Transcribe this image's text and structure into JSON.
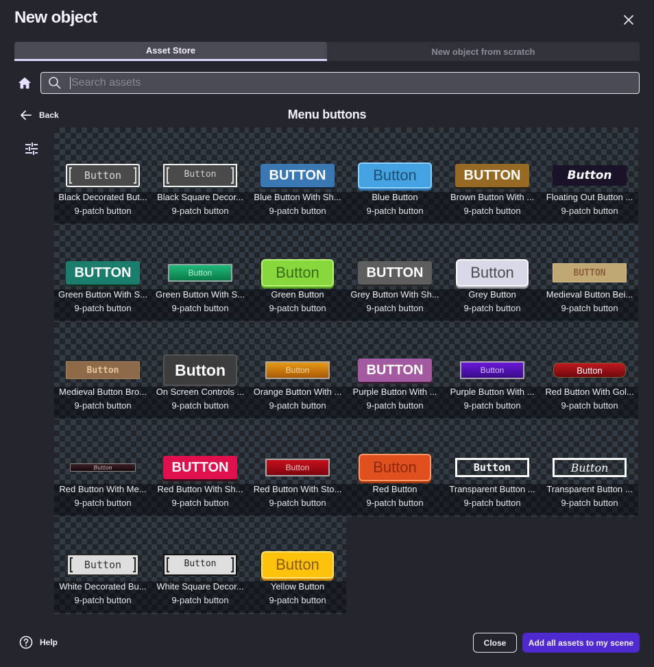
{
  "dialog": {
    "title": "New object",
    "close_icon": "close-icon"
  },
  "tabs": [
    {
      "label": "Asset Store",
      "active": true
    },
    {
      "label": "New object from scratch",
      "active": false
    }
  ],
  "search": {
    "placeholder": "Search assets",
    "value": "",
    "home_icon": "home-icon",
    "search_icon": "search-icon"
  },
  "nav": {
    "back_label": "Back",
    "section_title": "Menu buttons",
    "filter_icon": "tune-filter-icon"
  },
  "assets": [
    {
      "name": "Black Decorated But...",
      "kind": "9-patch button",
      "preview_text": "Button",
      "style": "black-decorated"
    },
    {
      "name": "Black Square Decor...",
      "kind": "9-patch button",
      "preview_text": "Button",
      "style": "black-square"
    },
    {
      "name": "Blue Button With Sh...",
      "kind": "9-patch button",
      "preview_text": "BUTTON",
      "style": "blue-shadow"
    },
    {
      "name": "Blue Button",
      "kind": "9-patch button",
      "preview_text": "Button",
      "style": "blue"
    },
    {
      "name": "Brown Button With ...",
      "kind": "9-patch button",
      "preview_text": "BUTTON",
      "style": "brown-shadow"
    },
    {
      "name": "Floating Out Button ...",
      "kind": "9-patch button",
      "preview_text": "Button",
      "style": "floating-out"
    },
    {
      "name": "Green Button With S...",
      "kind": "9-patch button",
      "preview_text": "BUTTON",
      "style": "green-shadow"
    },
    {
      "name": "Green Button With S...",
      "kind": "9-patch button",
      "preview_text": "Button",
      "style": "green-stone"
    },
    {
      "name": "Green Button",
      "kind": "9-patch button",
      "preview_text": "Button",
      "style": "green"
    },
    {
      "name": "Grey Button With Sh...",
      "kind": "9-patch button",
      "preview_text": "BUTTON",
      "style": "grey-shadow"
    },
    {
      "name": "Grey Button",
      "kind": "9-patch button",
      "preview_text": "Button",
      "style": "grey"
    },
    {
      "name": "Medieval Button Bei...",
      "kind": "9-patch button",
      "preview_text": "BUTTON",
      "style": "medieval-beige"
    },
    {
      "name": "Medieval Button Bro...",
      "kind": "9-patch button",
      "preview_text": "Button",
      "style": "medieval-brown"
    },
    {
      "name": "On Screen Controls ...",
      "kind": "9-patch button",
      "preview_text": "Button",
      "style": "on-screen"
    },
    {
      "name": "Orange Button With ...",
      "kind": "9-patch button",
      "preview_text": "Button",
      "style": "orange-stone"
    },
    {
      "name": "Purple Button With ...",
      "kind": "9-patch button",
      "preview_text": "BUTTON",
      "style": "purple-shadow"
    },
    {
      "name": "Purple Button With ...",
      "kind": "9-patch button",
      "preview_text": "Button",
      "style": "purple-stone"
    },
    {
      "name": "Red Button With Gol...",
      "kind": "9-patch button",
      "preview_text": "Button",
      "style": "red-gold"
    },
    {
      "name": "Red Button With Me...",
      "kind": "9-patch button",
      "preview_text": "Button",
      "style": "red-metal"
    },
    {
      "name": "Red Button With Sh...",
      "kind": "9-patch button",
      "preview_text": "BUTTON",
      "style": "red-shadow"
    },
    {
      "name": "Red Button With Sto...",
      "kind": "9-patch button",
      "preview_text": "Button",
      "style": "red-stone"
    },
    {
      "name": "Red Button",
      "kind": "9-patch button",
      "preview_text": "Button",
      "style": "red"
    },
    {
      "name": "Transparent Button ...",
      "kind": "9-patch button",
      "preview_text": "Button",
      "style": "transparent-pixel"
    },
    {
      "name": "Transparent Button ...",
      "kind": "9-patch button",
      "preview_text": "Button",
      "style": "transparent-serif"
    },
    {
      "name": "White Decorated Bu...",
      "kind": "9-patch button",
      "preview_text": "Button",
      "style": "white-decorated"
    },
    {
      "name": "White Square Decor...",
      "kind": "9-patch button",
      "preview_text": "Button",
      "style": "white-square"
    },
    {
      "name": "Yellow Button",
      "kind": "9-patch button",
      "preview_text": "Button",
      "style": "yellow"
    }
  ],
  "footer": {
    "help_label": "Help",
    "help_icon": "help-circle-icon",
    "close_label": "Close",
    "add_all_label": "Add all assets to my scene"
  },
  "colors": {
    "background": "#25252d",
    "accent": "#4f2ad0",
    "tab_indicator": "#dcd5ff"
  }
}
